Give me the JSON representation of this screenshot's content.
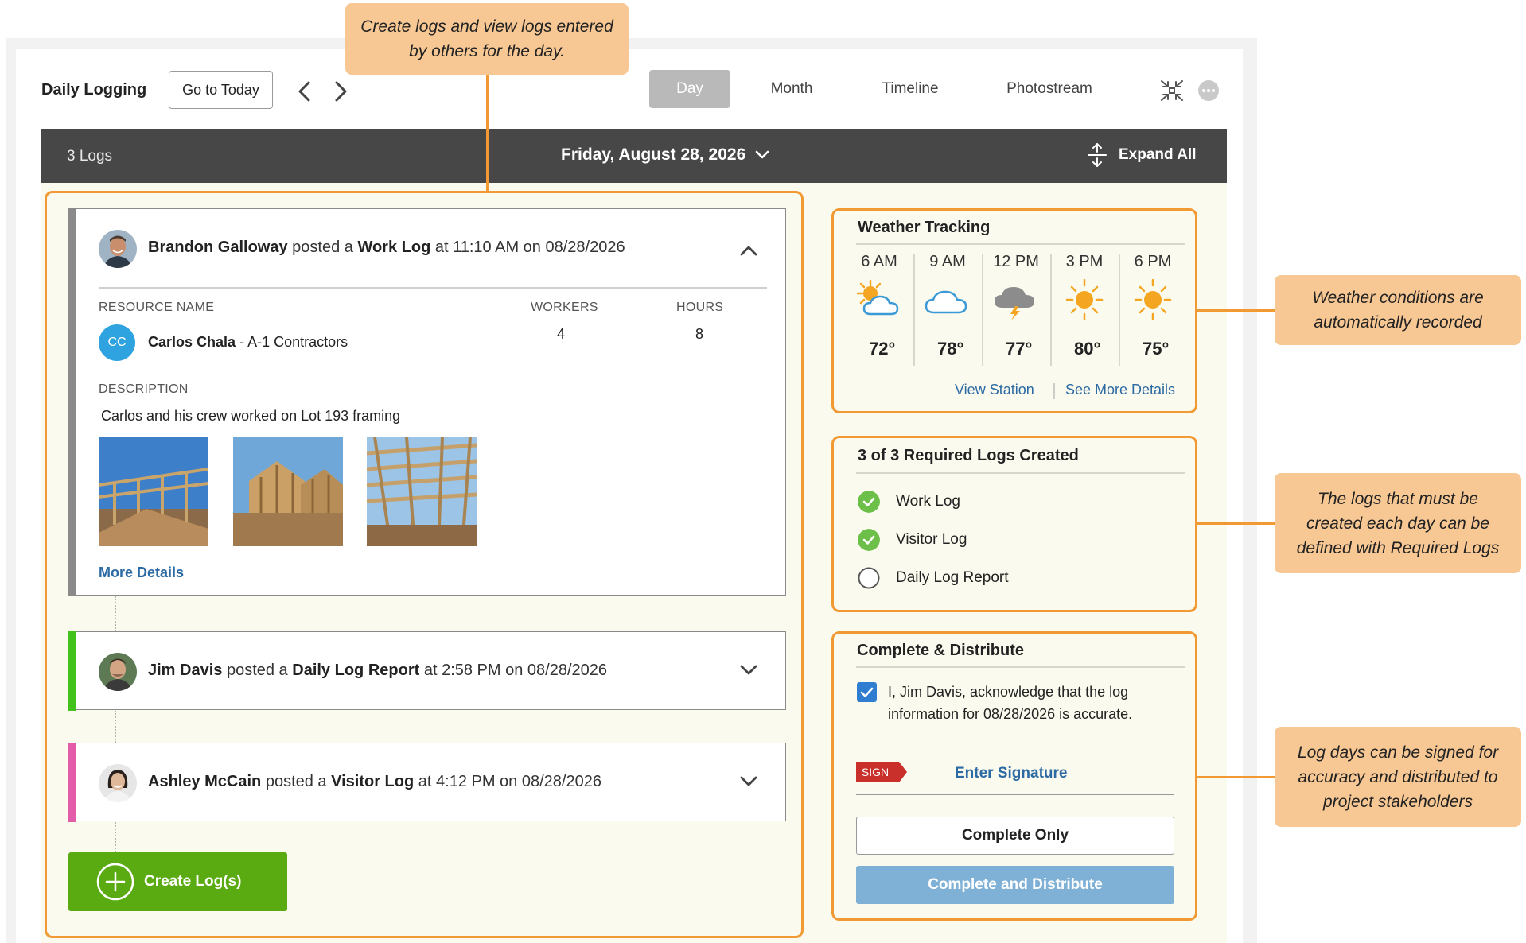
{
  "header": {
    "app_title": "Daily Logging",
    "go_to_today": "Go to Today",
    "tabs": [
      {
        "label": "Day",
        "active": true
      },
      {
        "label": "Month",
        "active": false
      },
      {
        "label": "Timeline",
        "active": false
      },
      {
        "label": "Photostream",
        "active": false
      }
    ]
  },
  "date_bar": {
    "log_count": "3 Logs",
    "date": "Friday, August 28, 2026",
    "expand_all": "Expand All"
  },
  "logs": [
    {
      "user": "Brandon Galloway",
      "posted_a": "posted a",
      "log_type": "Work Log",
      "when": "at 11:10 AM on 08/28/2026",
      "stripe_color": "#8a8a8a",
      "expanded": true
    },
    {
      "user": "Jim Davis",
      "posted_a": "posted a",
      "log_type": "Daily Log Report",
      "when": "at 2:58 PM on 08/28/2026",
      "stripe_color": "#44c21c",
      "expanded": false
    },
    {
      "user": "Ashley McCain",
      "posted_a": "posted a",
      "log_type": "Visitor Log",
      "when": "at 4:12 PM on 08/28/2026",
      "stripe_color": "#e35ca9",
      "expanded": false
    }
  ],
  "work_log": {
    "col_resource": "RESOURCE NAME",
    "col_workers": "WORKERS",
    "col_hours": "HOURS",
    "resource_initials": "CC",
    "resource_name": "Carlos Chala",
    "resource_company": "- A-1 Contractors",
    "workers": "4",
    "hours": "8",
    "description_label": "DESCRIPTION",
    "description": "Carlos and his crew worked on Lot 193 framing",
    "more_details": "More Details"
  },
  "create_button": "Create Log(s)",
  "weather": {
    "title": "Weather Tracking",
    "hours": [
      {
        "time": "6 AM",
        "temp": "72°",
        "icon": "partly-sunny-icon"
      },
      {
        "time": "9 AM",
        "temp": "78°",
        "icon": "cloud-icon"
      },
      {
        "time": "12 PM",
        "temp": "77°",
        "icon": "thunderstorm-icon"
      },
      {
        "time": "3 PM",
        "temp": "80°",
        "icon": "sun-icon"
      },
      {
        "time": "6 PM",
        "temp": "75°",
        "icon": "sun-icon"
      }
    ],
    "view_station": "View Station",
    "see_more": "See More Details"
  },
  "required_logs": {
    "title": "3 of 3 Required Logs Created",
    "items": [
      {
        "label": "Work Log",
        "done": true
      },
      {
        "label": "Visitor Log",
        "done": true
      },
      {
        "label": "Daily Log Report",
        "done": false
      }
    ]
  },
  "complete": {
    "title": "Complete & Distribute",
    "acknowledge": "I, Jim Davis, acknowledge that the log information for 08/28/2026 is accurate.",
    "sign_badge": "SIGN",
    "enter_signature": "Enter Signature",
    "complete_only": "Complete Only",
    "complete_distribute": "Complete and Distribute"
  },
  "callouts": {
    "top": "Create logs and view logs entered by others for the day.",
    "weather": "Weather conditions are automatically recorded",
    "required": "The logs that must be created each day can be defined with Required Logs",
    "sign": "Log days can be signed for accuracy and distributed to project stakeholders"
  },
  "colors": {
    "accent_orange": "#f19a34",
    "callout_fill": "#f8c894",
    "link_blue": "#2b6aa3",
    "create_green": "#5aab12",
    "check_green": "#6cc04a"
  }
}
